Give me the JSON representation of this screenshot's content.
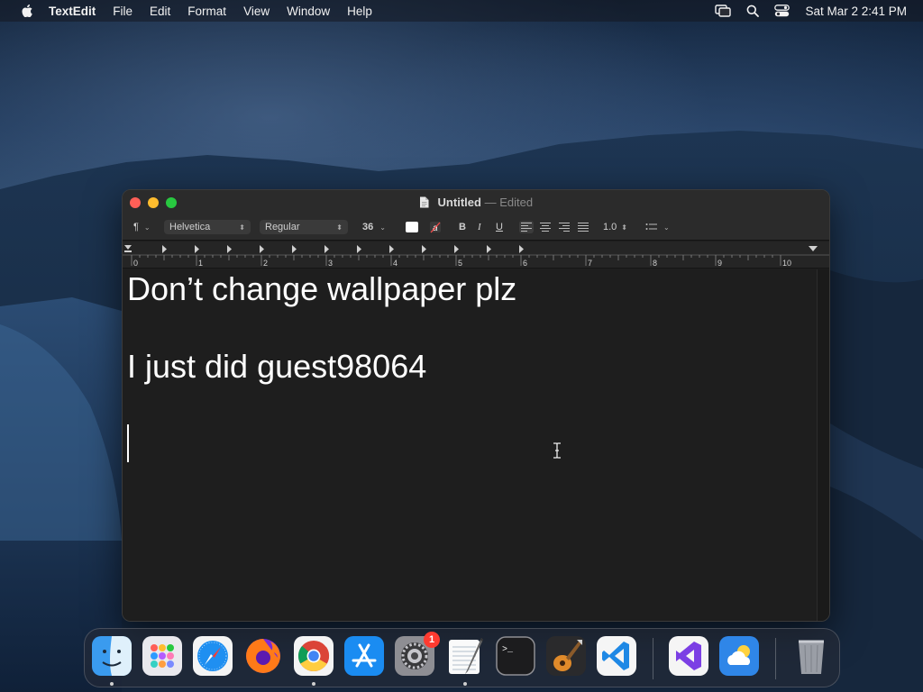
{
  "menubar": {
    "app_name": "TextEdit",
    "menus": [
      "File",
      "Edit",
      "Format",
      "View",
      "Window",
      "Help"
    ],
    "clock": "Sat Mar 2  2:41 PM"
  },
  "window": {
    "title": "Untitled",
    "title_separator": "—",
    "status": "Edited"
  },
  "toolbar": {
    "paragraph_symbol": "¶",
    "font_family": "Helvetica",
    "font_style": "Regular",
    "font_size": "36",
    "text_color": "#ffffff",
    "bold_label": "B",
    "italic_label": "I",
    "underline_label": "U",
    "line_spacing": "1.0"
  },
  "ruler": {
    "labels": [
      "0",
      "1",
      "2",
      "3",
      "4",
      "5",
      "6",
      "7",
      "8",
      "9",
      "10"
    ]
  },
  "document": {
    "lines": [
      "Don’t change wallpaper plz",
      "",
      "I just did guest98064",
      ""
    ]
  },
  "dock": {
    "apps": [
      "finder-icon",
      "launchpad-icon",
      "safari-icon",
      "firefox-icon",
      "chrome-icon",
      "app-store-icon",
      "system-settings-icon",
      "textedit-icon",
      "terminal-icon",
      "garageband-icon",
      "vscode-icon",
      "visual-studio-icon",
      "weather-icon",
      "trash-icon"
    ],
    "settings_badge": "1"
  },
  "colors": {
    "close": "#fe5f57",
    "minimize": "#febc2e",
    "zoom": "#28c840",
    "badge": "#ff3b30"
  }
}
